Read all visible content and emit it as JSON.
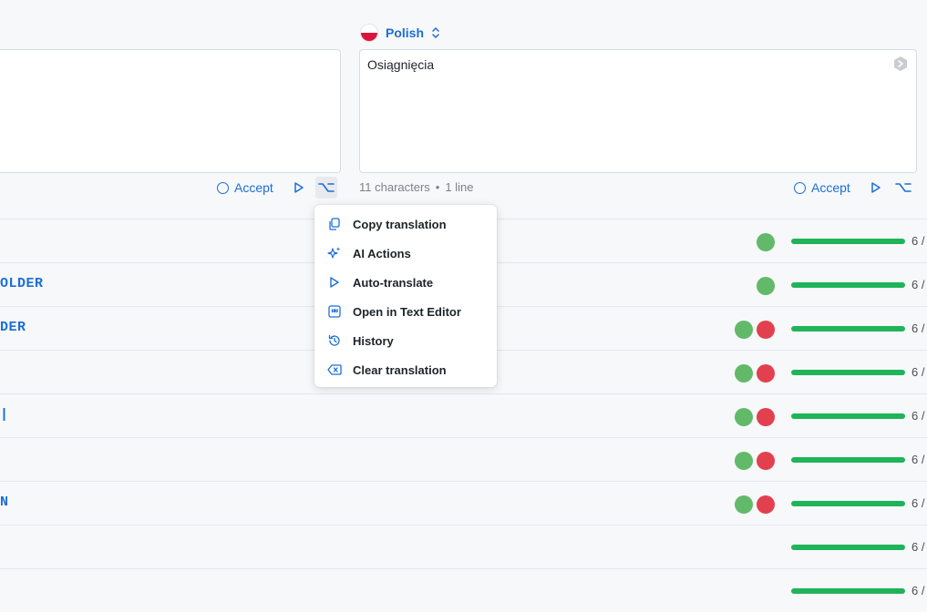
{
  "target": {
    "language": "Polish",
    "flag_colors": [
      "#ffffff",
      "#dc143c"
    ],
    "text": "Osiągnięcia",
    "meta": {
      "characters": "11 characters",
      "separator": "•",
      "lines": "1 line"
    },
    "accept_label": "Accept"
  },
  "source": {
    "accept_label": "Accept"
  },
  "menu": {
    "items": [
      {
        "label": "Copy translation",
        "icon": "copy-icon"
      },
      {
        "label": "AI Actions",
        "icon": "sparkle-icon"
      },
      {
        "label": "Auto-translate",
        "icon": "play-icon"
      },
      {
        "label": "Open in Text Editor",
        "icon": "quote-editor-icon"
      },
      {
        "label": "History",
        "icon": "history-icon"
      },
      {
        "label": "Clear translation",
        "icon": "clear-icon"
      }
    ]
  },
  "rows": [
    {
      "key": "",
      "statuses": [
        "green"
      ],
      "progress": 1.0,
      "count": "6 /"
    },
    {
      "key": "OLDER",
      "statuses": [
        "green"
      ],
      "progress": 1.0,
      "count": "6 /"
    },
    {
      "key": "DER",
      "statuses": [
        "green",
        "red"
      ],
      "progress": 1.0,
      "count": "6 /"
    },
    {
      "key": "",
      "statuses": [
        "green",
        "red"
      ],
      "progress": 1.0,
      "count": "6 /"
    },
    {
      "key": "|",
      "statuses": [
        "green",
        "red"
      ],
      "progress": 1.0,
      "count": "6 /"
    },
    {
      "key": "",
      "statuses": [
        "green",
        "red"
      ],
      "progress": 1.0,
      "count": "6 /"
    },
    {
      "key": "N",
      "statuses": [
        "green",
        "red"
      ],
      "progress": 1.0,
      "count": "6 /"
    },
    {
      "key": "",
      "statuses": [],
      "progress": 1.0,
      "count": "6 /"
    },
    {
      "key": "",
      "statuses": [],
      "progress": 1.0,
      "count": "6 /"
    }
  ],
  "colors": {
    "accent": "#1b6ed6",
    "success": "#1fb45a",
    "status_green": "#62b96a",
    "status_red": "#e2404f"
  }
}
